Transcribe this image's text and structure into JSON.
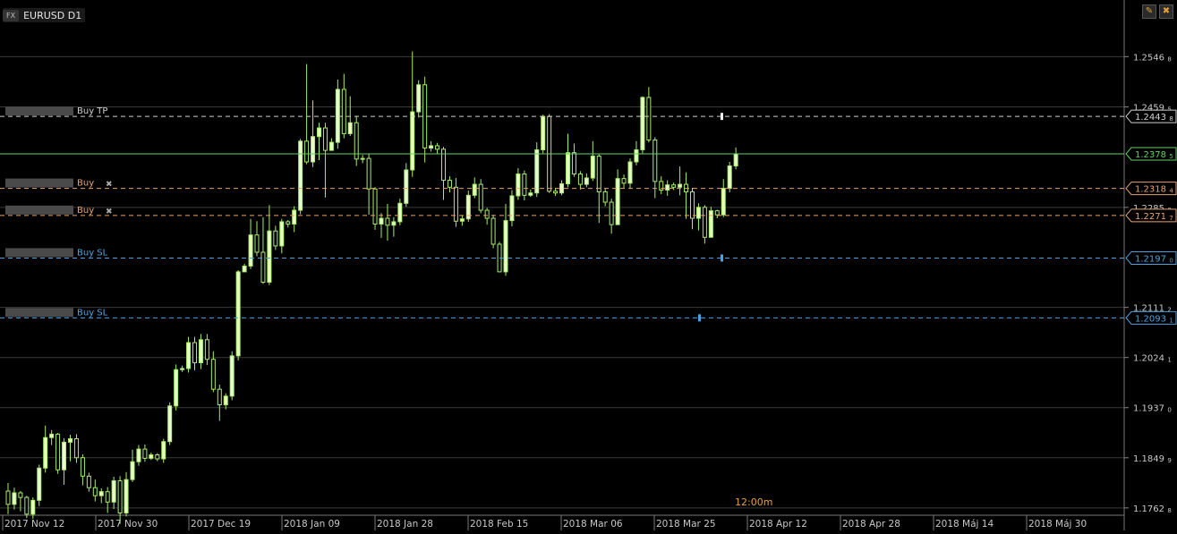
{
  "header": {
    "category": "FX",
    "symbol": "EURUSD D1"
  },
  "window_buttons": [
    {
      "name": "pencil-icon",
      "glyph": "✎"
    },
    {
      "name": "close-icon",
      "glyph": "✖"
    }
  ],
  "time_marker": "12:00m",
  "colors": {
    "bull_fill": "#e8ffc8",
    "bear_fill": "#000000",
    "candle_line": "#a8ec6a",
    "grid": "#3a3a3a",
    "current_price": "#5fd35f",
    "order": "#e8a46a",
    "stop_loss": "#4aa3e0",
    "take_profit": "#cfcfcf",
    "axis_text": "#c8c8c8"
  },
  "chart_data": {
    "type": "candlestick",
    "title": "EURUSD D1",
    "ylim": [
      1.1747,
      1.258
    ],
    "grid": true,
    "y_ticks": [
      "1.25468",
      "1.24595",
      "1.22850",
      "1.21112",
      "1.20241",
      "1.19370",
      "1.18499",
      "1.17628"
    ],
    "x_ticks": [
      "2017 Nov 12",
      "2017 Nov 30",
      "2017 Dec 19",
      "2018 Jan 09",
      "2018 Jan 28",
      "2018 Feb 15",
      "2018 Mar 06",
      "2018 Mar 25",
      "2018 Apr 12",
      "2018 Apr 28",
      "2018 Máj 14",
      "2018 Máj 30"
    ],
    "current_price": {
      "value": 1.2378,
      "label": "1.23785"
    },
    "lines": [
      {
        "name": "take-profit",
        "label": "Buy TP",
        "price": 1.2443,
        "price_label": "1.24438",
        "kind": "tp",
        "closable": false
      },
      {
        "name": "order-1",
        "label": "Buy",
        "price": 1.2318,
        "price_label": "1.23184",
        "kind": "order",
        "closable": true
      },
      {
        "name": "order-2",
        "label": "Buy",
        "price": 1.2271,
        "price_label": "1.22717",
        "kind": "order",
        "closable": true
      },
      {
        "name": "stop-loss-1",
        "label": "Buy SL",
        "price": 1.2197,
        "price_label": "1.21970",
        "kind": "sl",
        "closable": false
      },
      {
        "name": "stop-loss-2",
        "label": "Buy SL",
        "price": 1.2093,
        "price_label": "1.20931",
        "kind": "sl",
        "closable": false
      }
    ],
    "candles": [
      [
        1.1792,
        1.1769,
        1.1806,
        1.1752
      ],
      [
        1.1769,
        1.1789,
        1.1798,
        1.176
      ],
      [
        1.1789,
        1.1781,
        1.1792,
        1.1757
      ],
      [
        1.1781,
        1.1752,
        1.1784,
        1.1745
      ],
      [
        1.1752,
        1.1776,
        1.1781,
        1.1744
      ],
      [
        1.1776,
        1.1832,
        1.1838,
        1.1766
      ],
      [
        1.1832,
        1.1885,
        1.1906,
        1.1824
      ],
      [
        1.1885,
        1.1891,
        1.1898,
        1.1872
      ],
      [
        1.1891,
        1.1829,
        1.1893,
        1.1822
      ],
      [
        1.1829,
        1.1877,
        1.1884,
        1.1803
      ],
      [
        1.1877,
        1.1883,
        1.189,
        1.1844
      ],
      [
        1.1883,
        1.185,
        1.1891,
        1.1841
      ],
      [
        1.185,
        1.1818,
        1.1856,
        1.1802
      ],
      [
        1.1818,
        1.1798,
        1.1824,
        1.1791
      ],
      [
        1.1798,
        1.1784,
        1.1812,
        1.1774
      ],
      [
        1.1784,
        1.1791,
        1.1797,
        1.1771
      ],
      [
        1.1791,
        1.1773,
        1.1799,
        1.1754
      ],
      [
        1.1773,
        1.181,
        1.1817,
        1.1761
      ],
      [
        1.181,
        1.1754,
        1.1818,
        1.1735
      ],
      [
        1.1754,
        1.1812,
        1.1825,
        1.1748
      ],
      [
        1.1812,
        1.1843,
        1.1864,
        1.1808
      ],
      [
        1.1843,
        1.1865,
        1.1872,
        1.1836
      ],
      [
        1.1865,
        1.1849,
        1.1873,
        1.1843
      ],
      [
        1.1849,
        1.1855,
        1.1859,
        1.1846
      ],
      [
        1.1855,
        1.1848,
        1.1858,
        1.1844
      ],
      [
        1.1848,
        1.1878,
        1.1883,
        1.1841
      ],
      [
        1.1878,
        1.194,
        1.1946,
        1.1872
      ],
      [
        1.194,
        1.2003,
        1.2012,
        1.1932
      ],
      [
        1.2003,
        1.2005,
        1.201,
        1.1999
      ],
      [
        1.2005,
        1.205,
        1.206,
        1.1998
      ],
      [
        1.205,
        1.2015,
        1.206,
        1.2002
      ],
      [
        1.2015,
        1.2055,
        1.2065,
        1.2004
      ],
      [
        1.2055,
        1.2021,
        1.2065,
        1.2011
      ],
      [
        1.2021,
        1.1969,
        1.2035,
        1.1964
      ],
      [
        1.1969,
        1.1942,
        1.1977,
        1.1914
      ],
      [
        1.1942,
        1.1957,
        1.1962,
        1.1934
      ],
      [
        1.1957,
        1.2027,
        1.2035,
        1.195
      ],
      [
        1.2027,
        1.2173,
        1.2176,
        1.2019
      ],
      [
        1.2173,
        1.2183,
        1.2187,
        1.2173
      ],
      [
        1.2183,
        1.2237,
        1.2265,
        1.2178
      ],
      [
        1.2237,
        1.2207,
        1.2261,
        1.22
      ],
      [
        1.2207,
        1.2155,
        1.2268,
        1.2152
      ],
      [
        1.2155,
        1.2244,
        1.2289,
        1.215
      ],
      [
        1.2244,
        1.2218,
        1.2253,
        1.2211
      ],
      [
        1.2218,
        1.226,
        1.2265,
        1.2205
      ],
      [
        1.226,
        1.2256,
        1.2263,
        1.225
      ],
      [
        1.2256,
        1.228,
        1.2287,
        1.2242
      ],
      [
        1.228,
        1.24,
        1.2404,
        1.2273
      ],
      [
        1.24,
        1.2364,
        1.2534,
        1.236
      ],
      [
        1.2364,
        1.2408,
        1.2471,
        1.2355
      ],
      [
        1.2408,
        1.2423,
        1.2432,
        1.2367
      ],
      [
        1.2423,
        1.2384,
        1.2432,
        1.2302
      ],
      [
        1.2384,
        1.2398,
        1.2405,
        1.2388
      ],
      [
        1.2398,
        1.249,
        1.2507,
        1.2387
      ],
      [
        1.249,
        1.2413,
        1.2517,
        1.2405
      ],
      [
        1.2413,
        1.2432,
        1.2478,
        1.2409
      ],
      [
        1.2432,
        1.2369,
        1.2444,
        1.2357
      ],
      [
        1.2369,
        1.237,
        1.2376,
        1.2362
      ],
      [
        1.237,
        1.2317,
        1.2378,
        1.2272
      ],
      [
        1.2317,
        1.2256,
        1.232,
        1.2246
      ],
      [
        1.2256,
        1.2266,
        1.2275,
        1.2232
      ],
      [
        1.2266,
        1.2254,
        1.2291,
        1.2227
      ],
      [
        1.2254,
        1.226,
        1.2268,
        1.2234
      ],
      [
        1.226,
        1.2292,
        1.23,
        1.2254
      ],
      [
        1.2292,
        1.235,
        1.2362,
        1.2286
      ],
      [
        1.235,
        1.2451,
        1.2556,
        1.2338
      ],
      [
        1.2451,
        1.2498,
        1.2506,
        1.2441
      ],
      [
        1.2498,
        1.2388,
        1.2512,
        1.2363
      ],
      [
        1.2388,
        1.2392,
        1.24,
        1.2382
      ],
      [
        1.2392,
        1.2386,
        1.2397,
        1.2378
      ],
      [
        1.2386,
        1.2332,
        1.239,
        1.2298
      ],
      [
        1.2332,
        1.232,
        1.2339,
        1.2311
      ],
      [
        1.232,
        1.2261,
        1.2336,
        1.2251
      ],
      [
        1.2261,
        1.2265,
        1.2271,
        1.2253
      ],
      [
        1.2265,
        1.2306,
        1.2314,
        1.226
      ],
      [
        1.2306,
        1.2325,
        1.2337,
        1.2301
      ],
      [
        1.2325,
        1.228,
        1.2334,
        1.2275
      ],
      [
        1.228,
        1.2266,
        1.2284,
        1.2255
      ],
      [
        1.2266,
        1.2221,
        1.2272,
        1.2214
      ],
      [
        1.2221,
        1.2173,
        1.2225,
        1.2172
      ],
      [
        1.2173,
        1.2262,
        1.2291,
        1.2166
      ],
      [
        1.2262,
        1.2305,
        1.2315,
        1.2252
      ],
      [
        1.2305,
        1.2343,
        1.2353,
        1.2298
      ],
      [
        1.2343,
        1.2306,
        1.2349,
        1.2297
      ],
      [
        1.2306,
        1.231,
        1.2316,
        1.2303
      ],
      [
        1.231,
        1.2385,
        1.2398,
        1.2303
      ],
      [
        1.2385,
        1.2443,
        1.2446,
        1.2379
      ],
      [
        1.2443,
        1.2313,
        1.2447,
        1.231
      ],
      [
        1.2313,
        1.231,
        1.2319,
        1.2305
      ],
      [
        1.231,
        1.2326,
        1.2332,
        1.2306
      ],
      [
        1.2326,
        1.238,
        1.2413,
        1.232
      ],
      [
        1.238,
        1.2343,
        1.2396,
        1.2338
      ],
      [
        1.2343,
        1.2325,
        1.2348,
        1.2316
      ],
      [
        1.2325,
        1.2336,
        1.2344,
        1.232
      ],
      [
        1.2336,
        1.2374,
        1.24,
        1.2331
      ],
      [
        1.2374,
        1.2312,
        1.2378,
        1.2258
      ],
      [
        1.2312,
        1.2294,
        1.2317,
        1.2287
      ],
      [
        1.2294,
        1.2255,
        1.23,
        1.2239
      ],
      [
        1.2255,
        1.2335,
        1.2351,
        1.2255
      ],
      [
        1.2335,
        1.2327,
        1.2342,
        1.2319
      ],
      [
        1.2327,
        1.2364,
        1.237,
        1.2318
      ],
      [
        1.2364,
        1.2385,
        1.24,
        1.2358
      ],
      [
        1.2385,
        1.2476,
        1.2478,
        1.2377
      ],
      [
        1.2476,
        1.2402,
        1.2494,
        1.2398
      ],
      [
        1.2402,
        1.233,
        1.2407,
        1.2301
      ],
      [
        1.233,
        1.2315,
        1.2339,
        1.2308
      ],
      [
        1.2315,
        1.2324,
        1.2332,
        1.2305
      ],
      [
        1.2324,
        1.232,
        1.2328,
        1.2315
      ],
      [
        1.232,
        1.2325,
        1.2356,
        1.2306
      ],
      [
        1.2325,
        1.2312,
        1.2346,
        1.2265
      ],
      [
        1.2312,
        1.2266,
        1.2319,
        1.2247
      ],
      [
        1.2266,
        1.2285,
        1.2292,
        1.2245
      ],
      [
        1.2285,
        1.2233,
        1.2289,
        1.2222
      ],
      [
        1.2233,
        1.2279,
        1.2286,
        1.2233
      ],
      [
        1.2279,
        1.2272,
        1.2281,
        1.2266
      ],
      [
        1.2272,
        1.2318,
        1.2334,
        1.2268
      ],
      [
        1.2318,
        1.2357,
        1.2364,
        1.2311
      ],
      [
        1.2357,
        1.2378,
        1.2389,
        1.2351
      ]
    ]
  }
}
